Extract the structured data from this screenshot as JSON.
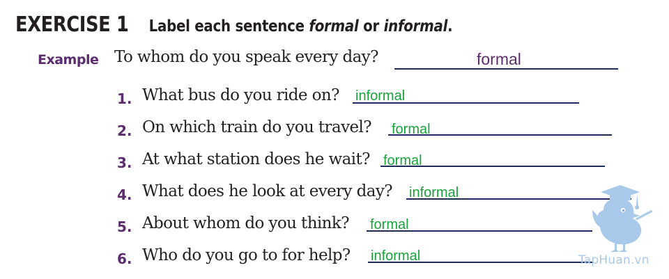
{
  "heading": {
    "exercise": "EXERCISE 1",
    "instruction_pre": "Label each sentence ",
    "word_formal": "formal",
    "word_or": " or ",
    "word_informal": "informal",
    "instruction_end": "."
  },
  "example": {
    "label": "Example",
    "sentence": "To whom do you speak every day?",
    "answer": "formal"
  },
  "items": [
    {
      "number": "1.",
      "sentence": "What bus do you ride on?",
      "answer": "informal"
    },
    {
      "number": "2.",
      "sentence": "On which train do you travel?",
      "answer": "formal"
    },
    {
      "number": "3.",
      "sentence": "At what station does he wait?",
      "answer": "formal"
    },
    {
      "number": "4.",
      "sentence": "What does he look at every day?",
      "answer": "informal"
    },
    {
      "number": "5.",
      "sentence": "About whom do you think?",
      "answer": "formal"
    },
    {
      "number": "6.",
      "sentence": "Who do you go to for help?",
      "answer": "informal"
    }
  ],
  "watermark": {
    "text": "TapHuan.vn",
    "icon": "bird-graduate-icon"
  },
  "colors": {
    "ink": "#231f20",
    "purple": "#5c2d6e",
    "green": "#1aa33a",
    "line": "#1f2a5c",
    "watermark": "#a9c9ea"
  }
}
